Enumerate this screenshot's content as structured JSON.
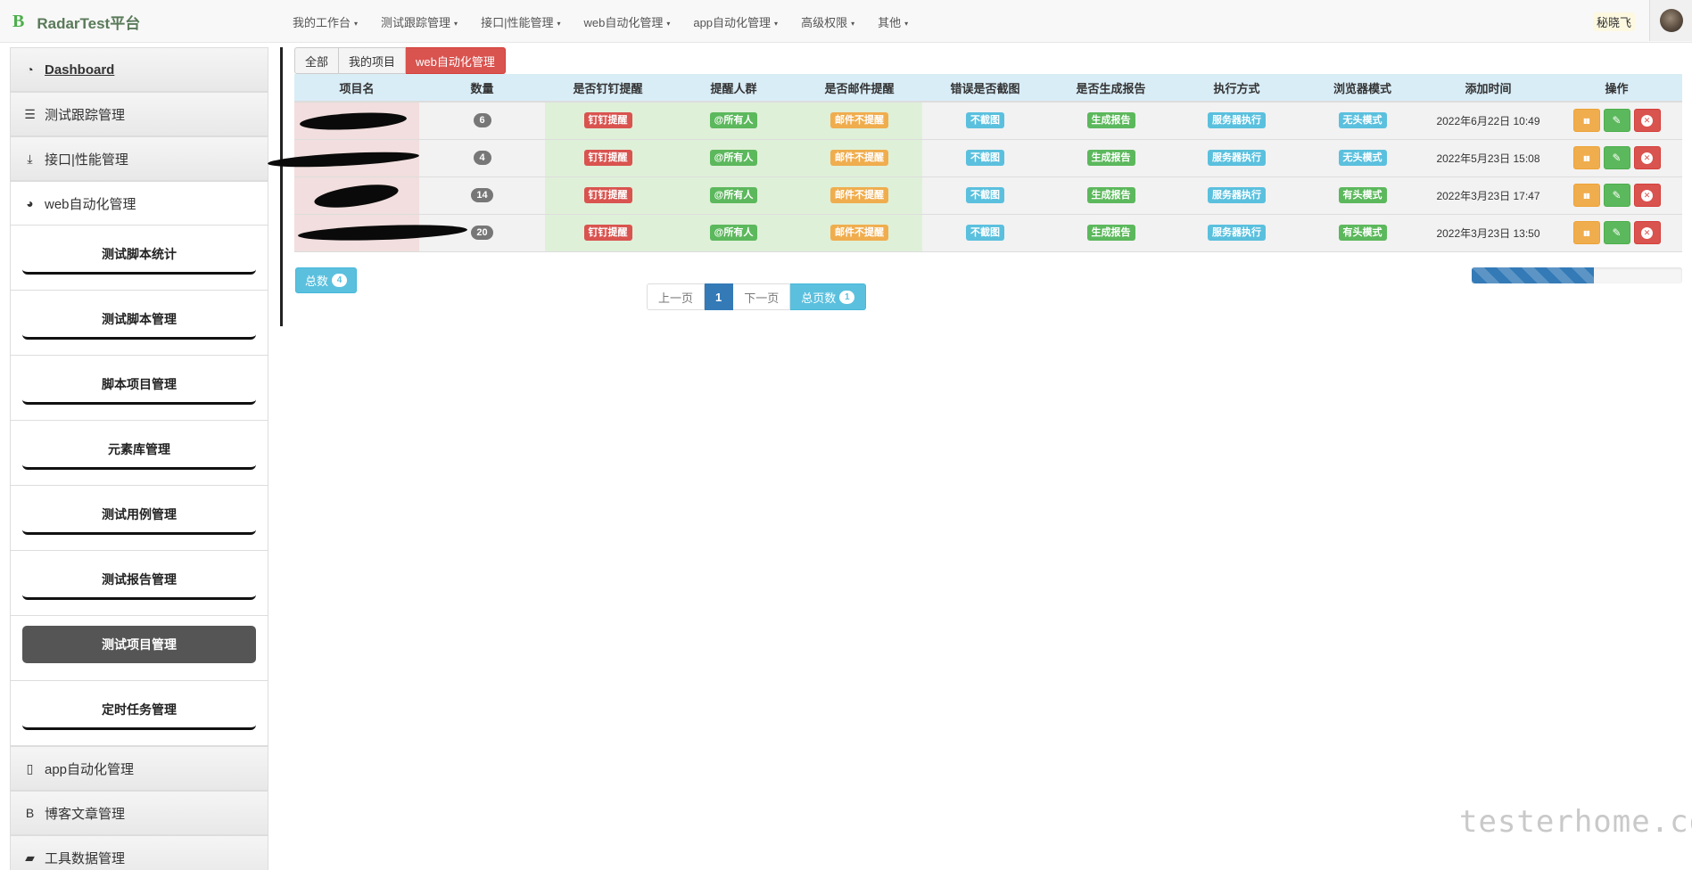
{
  "navbar": {
    "brand_logo": "B",
    "brand_name": "RadarTest平台",
    "menu": [
      {
        "label": "我的工作台"
      },
      {
        "label": "测试跟踪管理"
      },
      {
        "label": "接口|性能管理"
      },
      {
        "label": "web自动化管理"
      },
      {
        "label": "app自动化管理"
      },
      {
        "label": "高级权限"
      },
      {
        "label": "其他"
      }
    ],
    "caret": "▾",
    "user_name": "秘晓飞"
  },
  "sidebar": {
    "groups_top": [
      {
        "icon": "◔",
        "label": "Dashboard"
      },
      {
        "icon": "☰",
        "label": "测试跟踪管理"
      },
      {
        "icon": "⤓",
        "label": "接口|性能管理"
      },
      {
        "icon": "◕",
        "label": "web自动化管理"
      }
    ],
    "sub_items": [
      {
        "label": "测试脚本统计"
      },
      {
        "label": "测试脚本管理"
      },
      {
        "label": "脚本项目管理"
      },
      {
        "label": "元素库管理"
      },
      {
        "label": "测试用例管理"
      },
      {
        "label": "测试报告管理"
      },
      {
        "label": "测试项目管理"
      },
      {
        "label": "定时任务管理"
      }
    ],
    "groups_bottom": [
      {
        "icon": "▯",
        "label": "app自动化管理"
      },
      {
        "icon": "B",
        "label": "博客文章管理"
      },
      {
        "icon": "▰",
        "label": "工具数据管理"
      }
    ]
  },
  "filters": [
    {
      "label": "全部"
    },
    {
      "label": "我的项目"
    },
    {
      "label": "web自动化管理"
    }
  ],
  "table": {
    "headers": [
      "项目名",
      "数量",
      "是否钉钉提醒",
      "提醒人群",
      "是否邮件提醒",
      "错误是否截图",
      "是否生成报告",
      "执行方式",
      "浏览器模式",
      "添加时间",
      "操作"
    ],
    "rows": [
      {
        "name": "",
        "count": "6",
        "dingtalk": "钉钉提醒",
        "audience": "@所有人",
        "email": "邮件不提醒",
        "screenshot": "不截图",
        "report": "生成报告",
        "exec": "服务器执行",
        "browser": "无头模式",
        "time": "2022年6月22日 10:49"
      },
      {
        "name": "",
        "count": "4",
        "dingtalk": "钉钉提醒",
        "audience": "@所有人",
        "email": "邮件不提醒",
        "screenshot": "不截图",
        "report": "生成报告",
        "exec": "服务器执行",
        "browser": "无头模式",
        "time": "2022年5月23日 15:08"
      },
      {
        "name": "",
        "count": "14",
        "dingtalk": "钉钉提醒",
        "audience": "@所有人",
        "email": "邮件不提醒",
        "screenshot": "不截图",
        "report": "生成报告",
        "exec": "服务器执行",
        "browser": "有头模式",
        "time": "2022年3月23日 17:47"
      },
      {
        "name": "",
        "count": "20",
        "dingtalk": "钉钉提醒",
        "audience": "@所有人",
        "email": "邮件不提醒",
        "screenshot": "不截图",
        "report": "生成报告",
        "exec": "服务器执行",
        "browser": "有头模式",
        "time": "2022年3月23日 13:50"
      }
    ],
    "op_icons": {
      "chart": "▮▮",
      "edit": "✎",
      "delete": "✕"
    }
  },
  "summary": {
    "total_label": "总数",
    "total_count": "4"
  },
  "pagination": {
    "prev": "上一页",
    "current": "1",
    "next": "下一页",
    "total_pages_label": "总页数",
    "total_pages": "1"
  },
  "progress": {
    "percent": 58
  },
  "watermark": "testerhome.com",
  "colors": {
    "danger": "#d9534f",
    "success": "#5cb85c",
    "warning": "#f0ad4e",
    "info": "#5bc0de",
    "primary": "#337ab7",
    "header_bg": "#d9edf7"
  }
}
